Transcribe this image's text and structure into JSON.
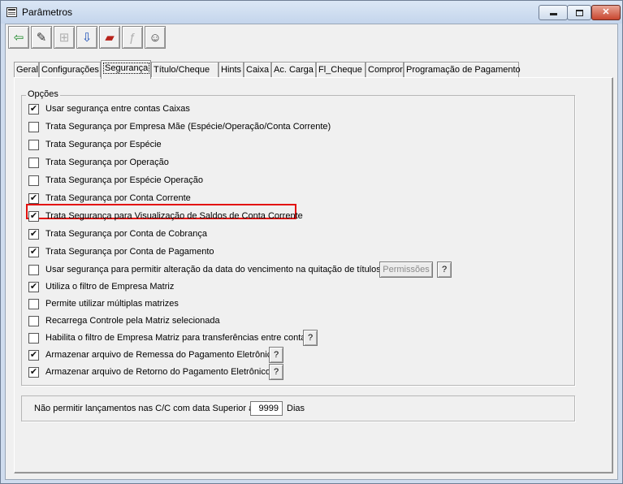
{
  "window": {
    "title": "Parâmetros",
    "controls": {
      "minimize": "minimize",
      "maximize": "maximize",
      "close": "✕"
    }
  },
  "toolbar": {
    "buttons": [
      {
        "icon": "exit-door-icon",
        "enabled": true
      },
      {
        "icon": "eraser-icon",
        "enabled": true
      },
      {
        "icon": "structure-icon",
        "enabled": false
      },
      {
        "icon": "save-download-icon",
        "enabled": true
      },
      {
        "icon": "open-folder-icon",
        "enabled": true
      },
      {
        "icon": "find-text-icon",
        "enabled": false
      },
      {
        "icon": "help-person-icon",
        "enabled": true
      }
    ]
  },
  "tabs": [
    "Geral",
    "Configurações",
    "Segurança",
    "Título/Cheque",
    "Hints",
    "Caixa",
    "Ac. Carga",
    "Fl_Cheque",
    "Compror",
    "Programação de Pagamento"
  ],
  "active_tab": "Segurança",
  "options_group": {
    "title": "Opções",
    "items": [
      {
        "label": "Usar segurança entre contas Caixas",
        "checked": true
      },
      {
        "label": "Trata Segurança por Empresa Mãe (Espécie/Operação/Conta Corrente)",
        "checked": false
      },
      {
        "label": "Trata Segurança por Espécie",
        "checked": false
      },
      {
        "label": "Trata Segurança por Operação",
        "checked": false
      },
      {
        "label": "Trata Segurança por Espécie Operação",
        "checked": false
      },
      {
        "label": "Trata Segurança por Conta Corrente",
        "checked": true
      },
      {
        "label": "Trata Segurança para Visualização de Saldos de Conta Corrente",
        "checked": true,
        "highlighted": true
      },
      {
        "label": "Trata Segurança por Conta de Cobrança",
        "checked": true
      },
      {
        "label": "Trata Segurança por Conta de Pagamento",
        "checked": true
      },
      {
        "label": "Usar segurança para permitir alteração da data do vencimento na quitação de títulos",
        "checked": false
      },
      {
        "label": "Utiliza o filtro de Empresa Matriz",
        "checked": true
      },
      {
        "label": "Permite utilizar múltiplas matrizes",
        "checked": false
      },
      {
        "label": "Recarrega Controle pela Matriz selecionada",
        "checked": false
      },
      {
        "label": "Habilita o filtro de Empresa Matriz para transferências entre contas",
        "checked": false
      },
      {
        "label": "Armazenar arquivo de Remessa do Pagamento Eletrônico",
        "checked": true
      },
      {
        "label": "Armazenar arquivo de Retorno do Pagamento Eletrônico",
        "checked": true
      }
    ],
    "permissions_button": "Permissões",
    "help_button": "?"
  },
  "date_limit": {
    "label": "Não permitir lançamentos nas C/C com data Superior a",
    "value": "9999",
    "unit": "Dias"
  }
}
